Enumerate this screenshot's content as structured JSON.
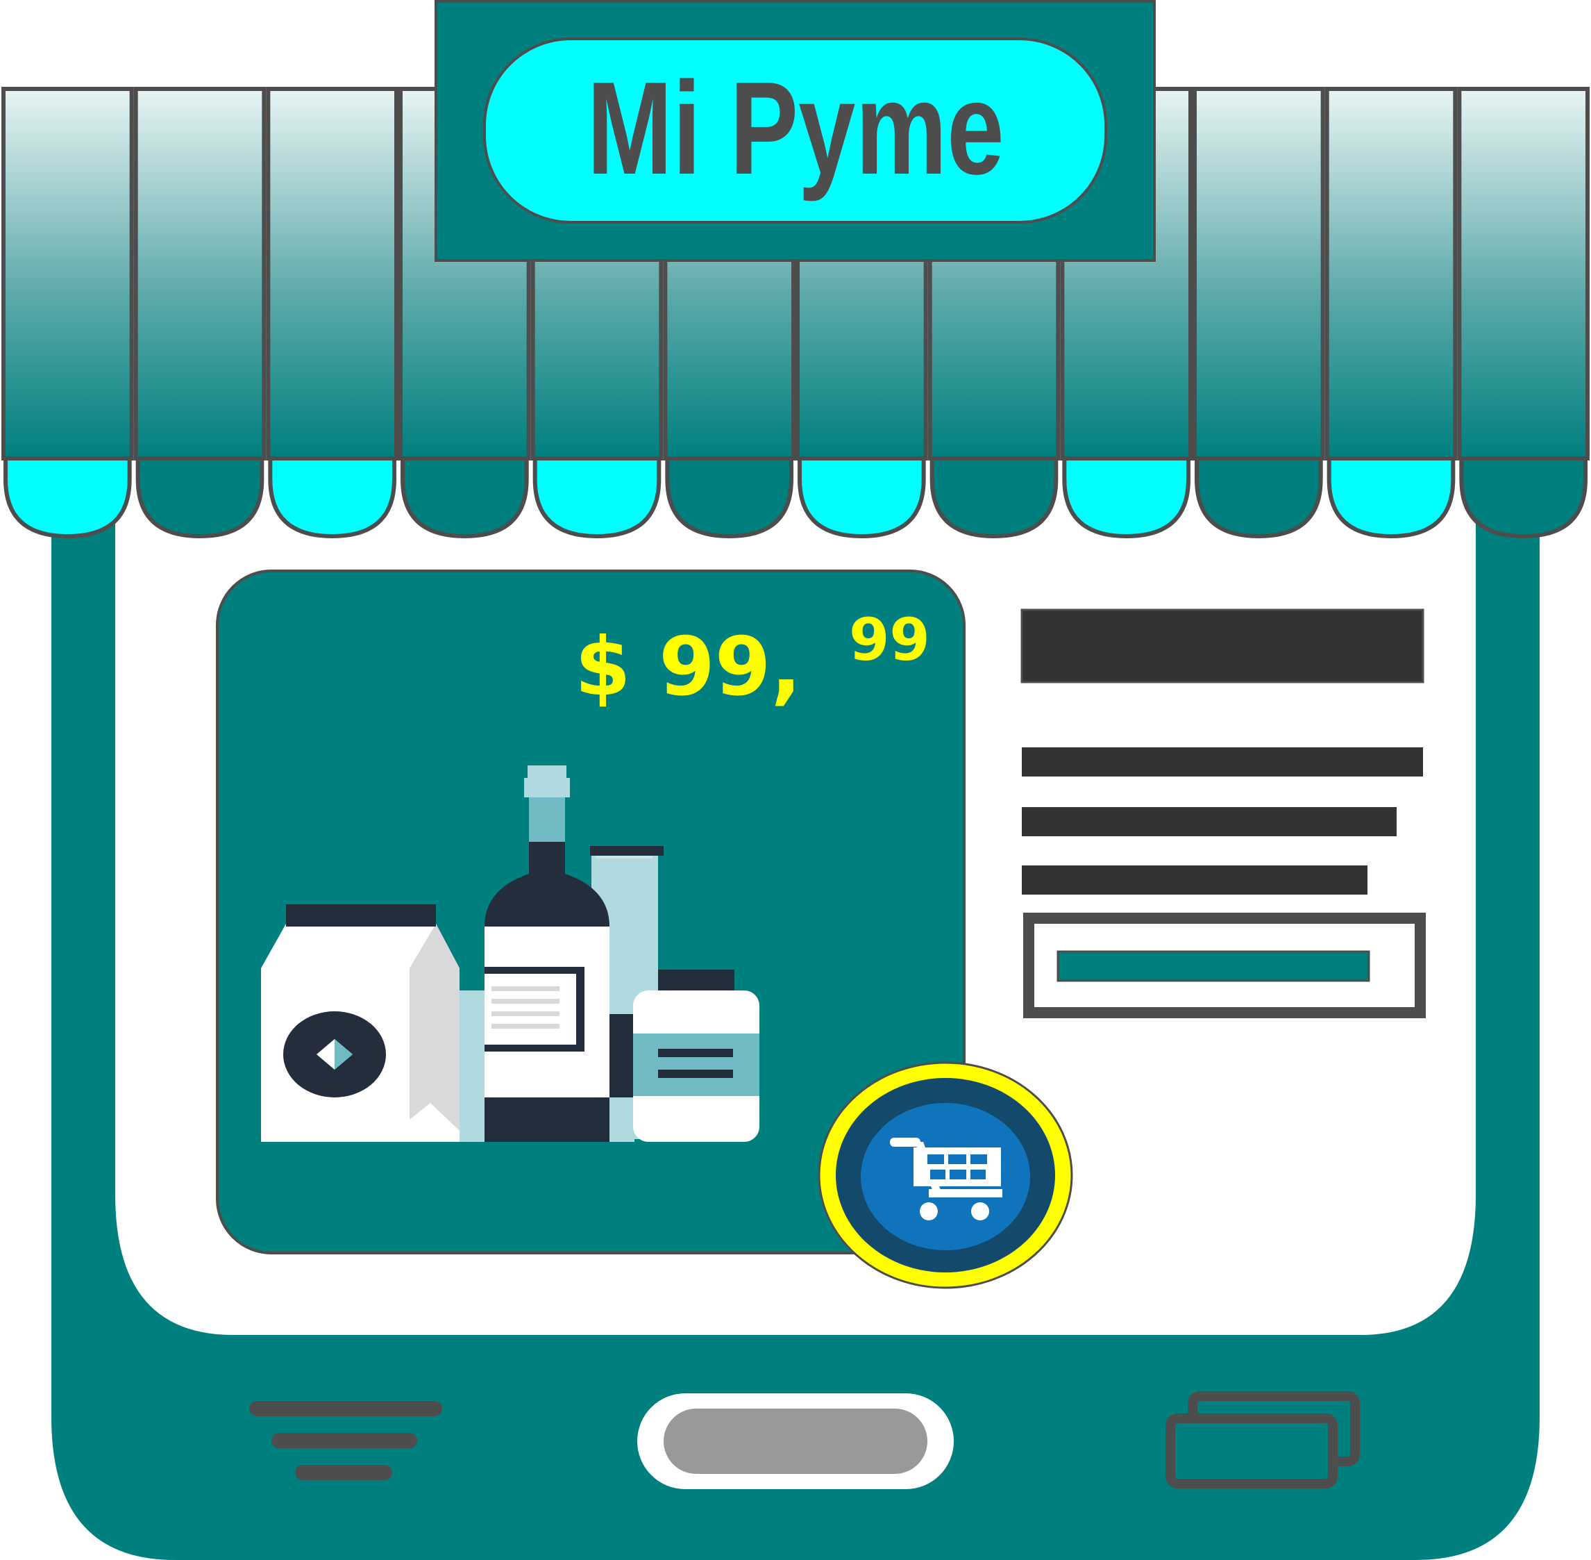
{
  "store": {
    "name": "Mi Pyme"
  },
  "product": {
    "price_main": "$ 99,",
    "price_cents": "99"
  },
  "icons": {
    "cart": "shopping-cart-icon",
    "products": "products-illustration-icon",
    "menu": "menu-lines-icon",
    "home": "home-pill-icon",
    "recents": "recent-apps-icon"
  },
  "colors": {
    "teal": "#007F7F",
    "cyan": "#00FFFF",
    "price": "#FFFF00",
    "cart_ring": "#FFFF00",
    "cart_inner": "#1074BC",
    "cart_outer": "#134A6C",
    "text_bar": "#333333",
    "accent_bar": "#007F7F",
    "outline": "#4D4D4D"
  }
}
